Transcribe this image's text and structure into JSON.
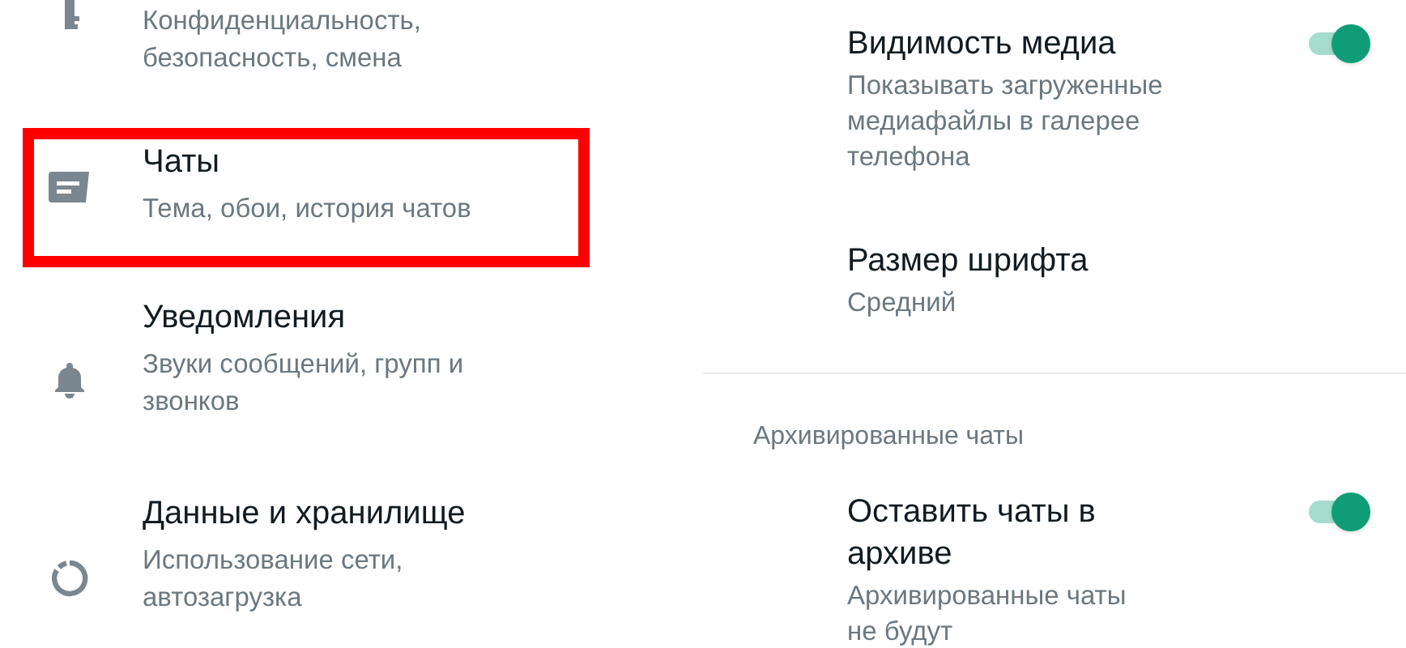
{
  "left_items": [
    {
      "kind": "key",
      "subtitle": "Конфиденциальность, безопасность, смена",
      "highlighted": false
    },
    {
      "kind": "chat",
      "title": "Чаты",
      "subtitle": "Тема, обои, история чатов",
      "highlighted": true
    },
    {
      "kind": "bell",
      "title": "Уведомления",
      "subtitle": "Звуки сообщений, групп и звонков",
      "highlighted": false
    },
    {
      "kind": "data",
      "title": "Данные и хранилище",
      "subtitle": "Использование сети, автозагрузка",
      "highlighted": false
    }
  ],
  "right_sections": [
    {
      "items": [
        {
          "title": "Видимость медиа",
          "subtitle": "Показывать загруженные медиафайлы в галерее телефона",
          "on": true
        },
        {
          "title": "Размер шрифта",
          "subtitle": "Средний"
        }
      ]
    },
    {
      "header": "Архивированные чаты",
      "items": [
        {
          "title": "Оставить чаты в архиве",
          "subtitle": "Архивированные чаты не будут",
          "on": true
        }
      ]
    }
  ]
}
